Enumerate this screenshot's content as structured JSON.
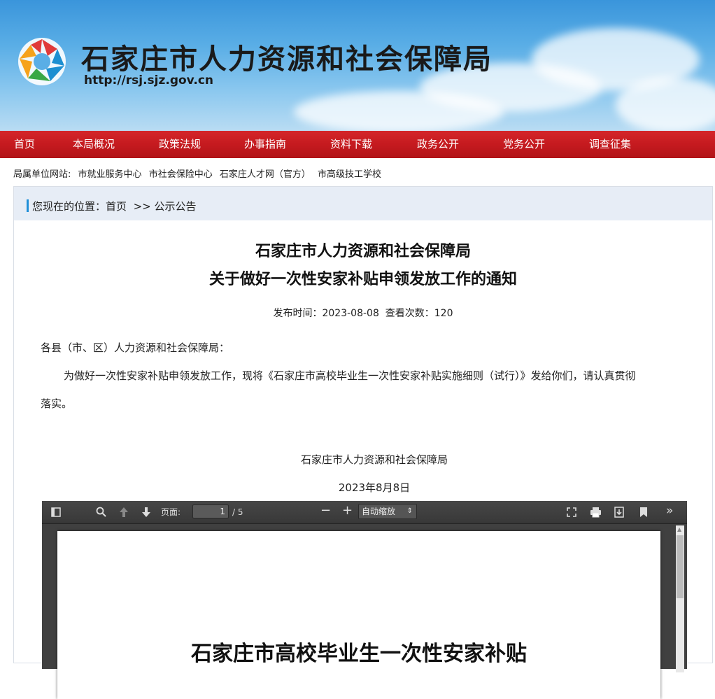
{
  "header": {
    "site_title": "石家庄市人力资源和社会保障局",
    "site_url": "http://rsj.sjz.gov.cn"
  },
  "nav": {
    "items": [
      "首页",
      "本局概况",
      "政策法规",
      "办事指南",
      "资料下载",
      "政务公开",
      "党务公开",
      "调查征集"
    ]
  },
  "affiliates": {
    "label": "局属单位网站:",
    "links": [
      "市就业服务中心",
      "市社会保险中心",
      "石家庄人才网（官方）",
      "市高级技工学校"
    ]
  },
  "breadcrumb": {
    "prefix": "您现在的位置：",
    "home": "首页",
    "separator": ">>",
    "current": "公示公告"
  },
  "article": {
    "title_line1": "石家庄市人力资源和社会保障局",
    "title_line2": "关于做好一次性安家补贴申领发放工作的通知",
    "publish_label": "发布时间：",
    "publish_date": "2023-08-08",
    "views_label": "查看次数：",
    "views": "120",
    "salutation": "各县（市、区）人力资源和社会保障局：",
    "body_line1": "为做好一次性安家补贴申领发放工作，现将《石家庄市高校毕业生一次性安家补贴实施细则（试行）》发给你们，请认真贯彻",
    "body_line2": "落实。",
    "signature_org": "石家庄市人力资源和社会保障局",
    "signature_date": "2023年8月8日"
  },
  "pdf_viewer": {
    "page_label": "页面:",
    "page_current": "1",
    "page_total": "/ 5",
    "zoom_value": "自动缩放",
    "page_text": "石家庄市高校毕业生一次性安家补贴"
  }
}
